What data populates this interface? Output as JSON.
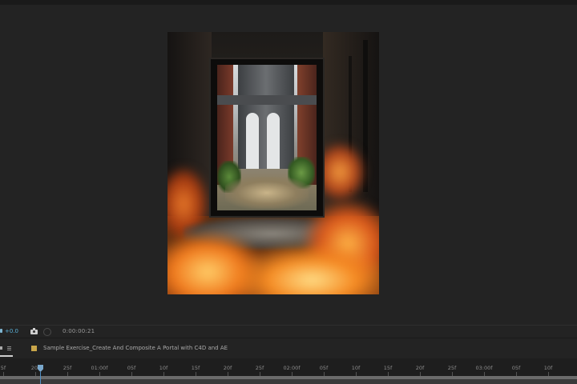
{
  "viewer": {
    "zoom_value": "+0.0",
    "timecode": "0:00:00:21"
  },
  "timeline": {
    "comp_title": "Sample Exercise_Create And Composite A Portal with C4D and AE",
    "ruler_labels": [
      "5f",
      "20f",
      "25f",
      "01:00f",
      "05f",
      "10f",
      "15f",
      "20f",
      "25f",
      "02:00f",
      "05f",
      "10f",
      "15f",
      "20f",
      "25f",
      "03:00f",
      "05f",
      "10f"
    ]
  },
  "colors": {
    "panel_bg": "#232323",
    "comp_swatch": "#c9a64a",
    "playhead": "#4f8fc6",
    "accent_value": "#5ab0d8"
  },
  "icons": {
    "snapshot": "camera-icon",
    "show_channel": "color-circle-icon",
    "panel_menu": "hamburger-menu-icon",
    "comp_label": "label-swatch-icon"
  }
}
